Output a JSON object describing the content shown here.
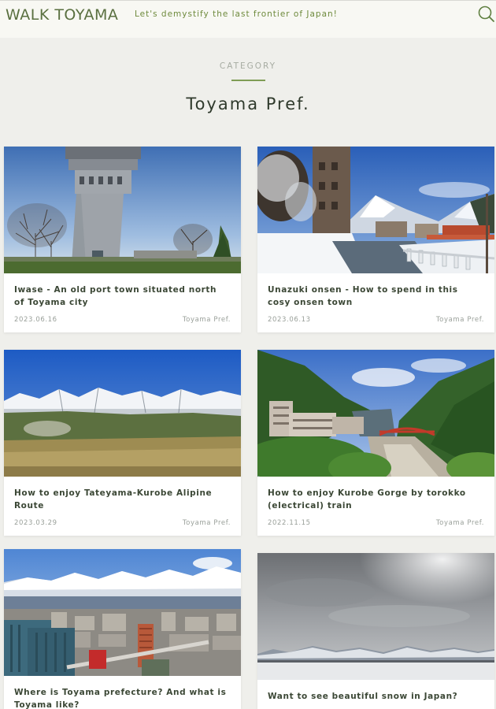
{
  "header": {
    "logo": "WALK TOYAMA",
    "tagline": "Let's demystify the last frontier of Japan!",
    "search_icon": "search-icon"
  },
  "section": {
    "label": "CATEGORY",
    "title": "Toyama Pref."
  },
  "accent_color": "#7f9d55",
  "cards": [
    {
      "title": "Iwase - An old port town situated north of Toyama city",
      "date": "2023.06.16",
      "category": "Toyama Pref.",
      "image": "tower-photo"
    },
    {
      "title": "Unazuki onsen - How to spend in this cosy onsen town",
      "date": "2023.06.13",
      "category": "Toyama Pref.",
      "image": "snowy-town-photo"
    },
    {
      "title": "How to enjoy Tateyama-Kurobe Alipine Route",
      "date": "2023.03.29",
      "category": "Toyama Pref.",
      "image": "mountain-plateau-photo"
    },
    {
      "title": "How to enjoy Kurobe Gorge by torokko (electrical) train",
      "date": "2022.11.15",
      "category": "Toyama Pref.",
      "image": "gorge-photo"
    },
    {
      "title": "Where is Toyama prefecture? And what is Toyama like?",
      "date": "",
      "category": "",
      "image": "city-mountains-photo"
    },
    {
      "title": "Want to see beautiful snow in Japan?",
      "date": "",
      "category": "",
      "image": "snow-field-photo"
    }
  ]
}
